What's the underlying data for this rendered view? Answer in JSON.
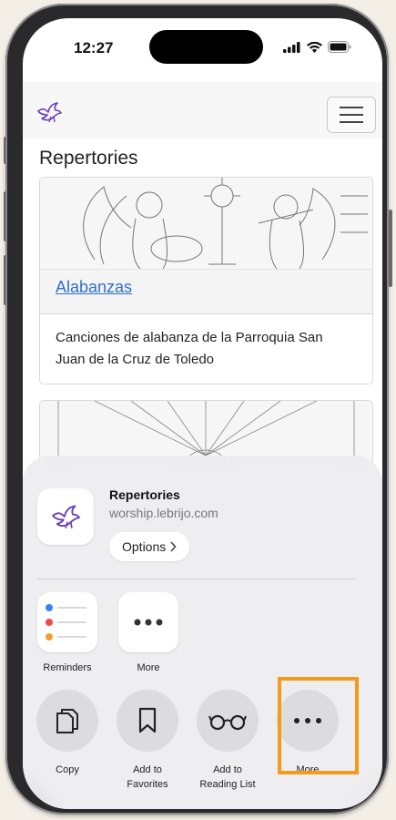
{
  "status_bar": {
    "time": "12:27"
  },
  "page": {
    "title": "Repertories",
    "cards": [
      {
        "link": "Alabanzas",
        "description": "Canciones de alabanza de la Parroquia San Juan de la Cruz de Toledo"
      }
    ]
  },
  "share_sheet": {
    "site_title": "Repertories",
    "site_url": "worship.lebrijo.com",
    "options_label": "Options",
    "apps": [
      {
        "label": "Reminders",
        "icon": "reminders-icon"
      },
      {
        "label": "More",
        "icon": "ellipsis-icon"
      }
    ],
    "actions": [
      {
        "label": "Copy",
        "icon": "copy-icon"
      },
      {
        "label": "Add to\nFavorites",
        "icon": "bookmark-icon"
      },
      {
        "label": "Add to\nReading List",
        "icon": "glasses-icon"
      },
      {
        "label": "More",
        "icon": "ellipsis-icon"
      }
    ]
  },
  "colors": {
    "accent_link": "#2f6fd1",
    "highlight": "#f59a1b",
    "logo": "#6a3fb4"
  }
}
